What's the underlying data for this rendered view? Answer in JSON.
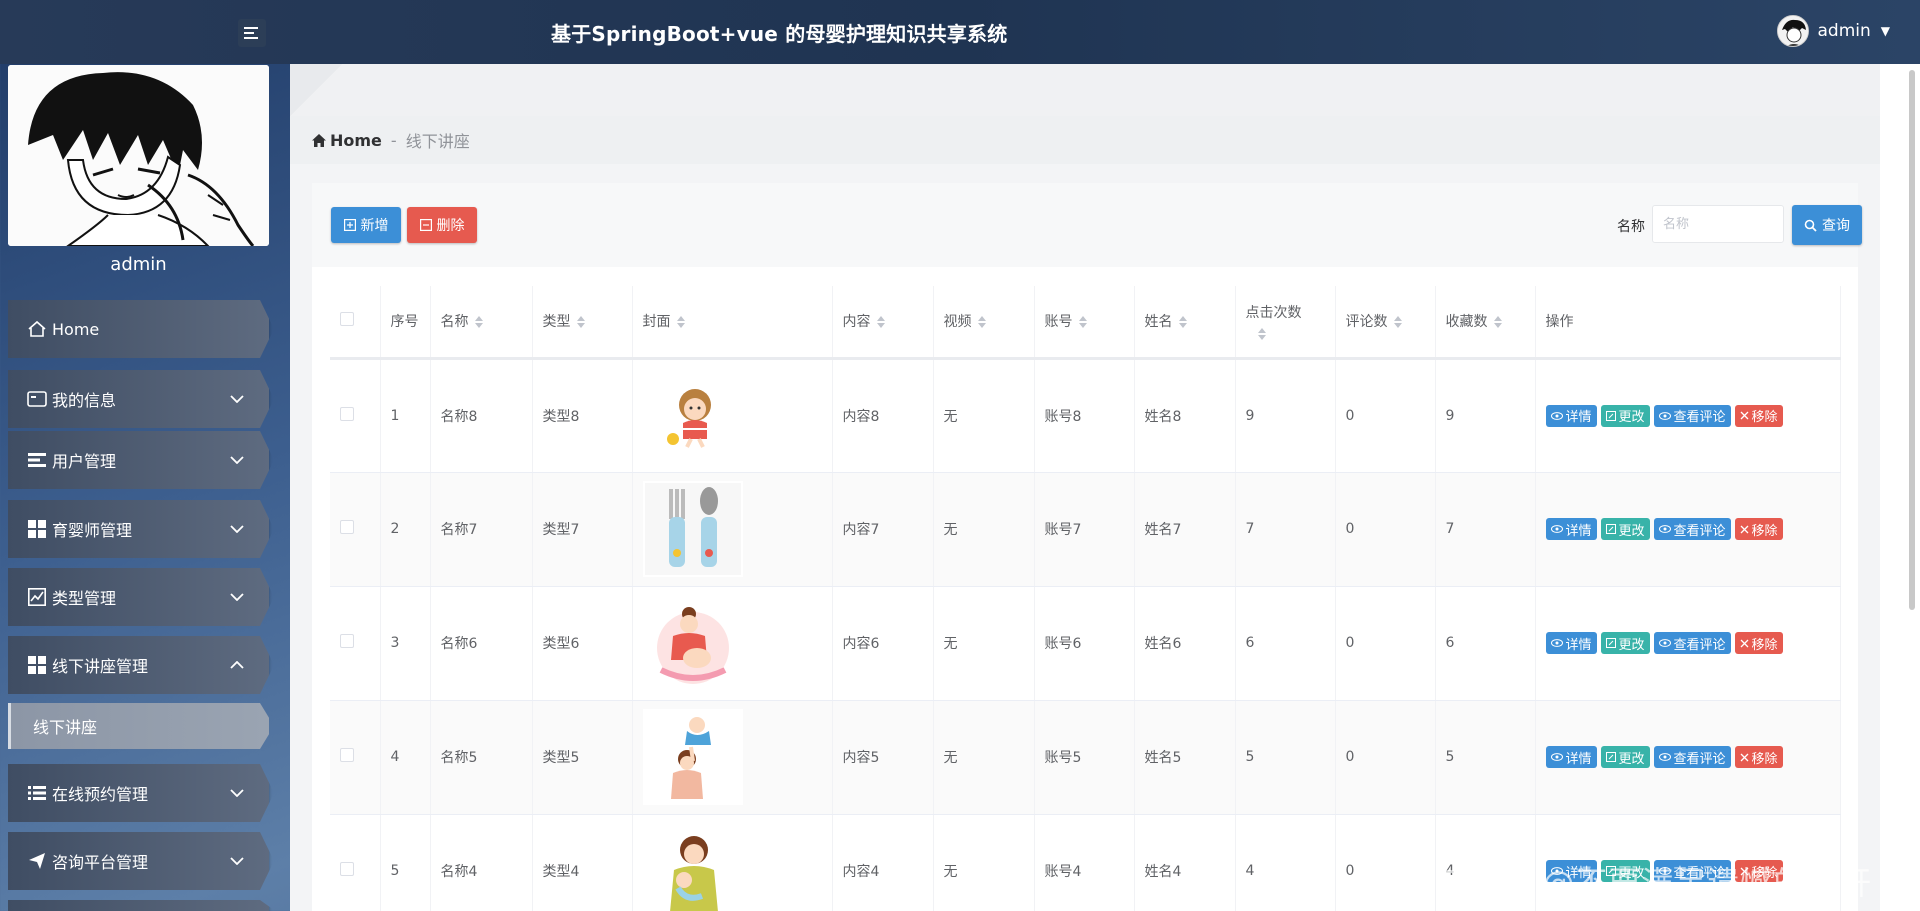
{
  "header": {
    "title": "基于SpringBoot+vue 的母婴护理知识共享系统",
    "username": "admin",
    "menu_toggle_icon": "menu-fold-icon"
  },
  "sidebar": {
    "username": "admin",
    "items": [
      {
        "label": "Home",
        "icon": "home-icon"
      },
      {
        "label": "我的信息",
        "icon": "id-card-icon"
      },
      {
        "label": "用户管理",
        "icon": "user-list-icon"
      },
      {
        "label": "育婴师管理",
        "icon": "grid-icon"
      },
      {
        "label": "类型管理",
        "icon": "chart-icon"
      },
      {
        "label": "线下讲座管理",
        "icon": "grid-icon"
      },
      {
        "label": "在线预约管理",
        "icon": "list-icon"
      },
      {
        "label": "咨询平台管理",
        "icon": "send-icon"
      }
    ],
    "sub_item": "线下讲座"
  },
  "breadcrumb": {
    "home": "Home",
    "separator": "-",
    "current": "线下讲座"
  },
  "toolbar": {
    "add_label": "新增",
    "delete_label": "删除",
    "search_label": "名称",
    "search_placeholder": "名称",
    "search_button": "查询"
  },
  "table": {
    "headers": [
      "序号",
      "名称",
      "类型",
      "封面",
      "内容",
      "视频",
      "账号",
      "姓名",
      "点击次数",
      "评论数",
      "收藏数",
      "操作"
    ],
    "rows": [
      {
        "no": "1",
        "name": "名称8",
        "type": "类型8",
        "content": "内容8",
        "video": "无",
        "account": "账号8",
        "person": "姓名8",
        "clicks": "9",
        "comments": "0",
        "favorites": "9"
      },
      {
        "no": "2",
        "name": "名称7",
        "type": "类型7",
        "content": "内容7",
        "video": "无",
        "account": "账号7",
        "person": "姓名7",
        "clicks": "7",
        "comments": "0",
        "favorites": "7"
      },
      {
        "no": "3",
        "name": "名称6",
        "type": "类型6",
        "content": "内容6",
        "video": "无",
        "account": "账号6",
        "person": "姓名6",
        "clicks": "6",
        "comments": "0",
        "favorites": "6"
      },
      {
        "no": "4",
        "name": "名称5",
        "type": "类型5",
        "content": "内容5",
        "video": "无",
        "account": "账号5",
        "person": "姓名5",
        "clicks": "5",
        "comments": "0",
        "favorites": "5"
      },
      {
        "no": "5",
        "name": "名称4",
        "type": "类型4",
        "content": "内容4",
        "video": "无",
        "account": "账号4",
        "person": "姓名4",
        "clicks": "4",
        "comments": "0",
        "favorites": "4"
      }
    ],
    "ops": {
      "detail": "详情",
      "edit": "更改",
      "comments": "查看评论",
      "remove": "移除"
    }
  },
  "watermark": "CSDN @不要满足遗憾的离开",
  "colors": {
    "primary": "#3c8fd7",
    "danger": "#e65a4f",
    "success": "#38b3a9",
    "header_bg": "#1f3452"
  }
}
